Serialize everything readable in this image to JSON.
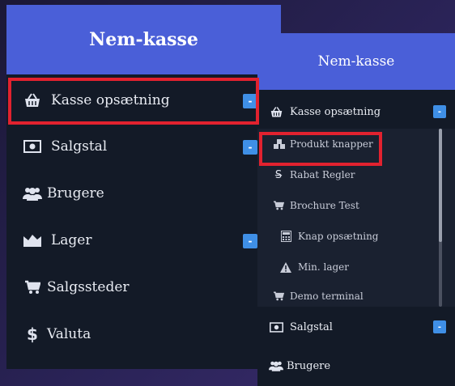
{
  "left_panel": {
    "title": "Nem-kasse",
    "items": [
      {
        "label": "Kasse opsætning",
        "icon": "basket-icon",
        "badge": "-"
      },
      {
        "label": "Salgstal",
        "icon": "money-icon",
        "badge": "-"
      },
      {
        "label": "Brugere",
        "icon": "users-icon"
      },
      {
        "label": "Lager",
        "icon": "chart-area-icon",
        "badge": "-"
      },
      {
        "label": "Salgssteder",
        "icon": "cart-icon"
      },
      {
        "label": "Valuta",
        "icon": "dollar-icon"
      }
    ]
  },
  "right_panel": {
    "title": "Nem-kasse",
    "section": {
      "label": "Kasse opsætning",
      "icon": "basket-icon",
      "badge": "-"
    },
    "sub_items": [
      {
        "label": "Produkt knapper",
        "icon": "cubes-icon"
      },
      {
        "label": "Rabat Regler",
        "icon": "strikethrough-icon"
      },
      {
        "label": "Brochure Test",
        "icon": "cart-icon"
      },
      {
        "label": "Knap opsætning",
        "icon": "calculator-icon"
      },
      {
        "label": "Min. lager",
        "icon": "warning-icon"
      },
      {
        "label": "Demo terminal",
        "icon": "cart-icon"
      }
    ],
    "items": [
      {
        "label": "Salgstal",
        "icon": "money-icon",
        "badge": "-"
      },
      {
        "label": "Brugere",
        "icon": "users-icon"
      }
    ]
  },
  "colors": {
    "sidebar_bg": "#131a27",
    "header_bg": "#4a5fd8",
    "badge_bg": "#3f8fe6",
    "highlight": "#e2222f"
  }
}
